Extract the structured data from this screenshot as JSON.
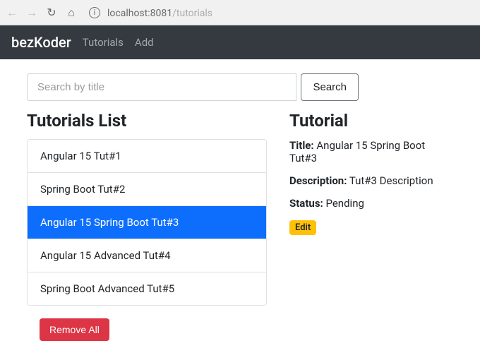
{
  "browser": {
    "host": "localhost:",
    "port": "8081",
    "path": "/tutorials"
  },
  "navbar": {
    "brand": "bezKoder",
    "links": [
      "Tutorials",
      "Add"
    ]
  },
  "search": {
    "placeholder": "Search by title",
    "button": "Search"
  },
  "list": {
    "heading": "Tutorials List",
    "items": [
      "Angular 15 Tut#1",
      "Spring Boot Tut#2",
      "Angular 15 Spring Boot Tut#3",
      "Angular 15 Advanced Tut#4",
      "Spring Boot Advanced Tut#5"
    ],
    "activeIndex": 2,
    "removeAll": "Remove All"
  },
  "detail": {
    "heading": "Tutorial",
    "titleLabel": "Title:",
    "titleValue": "Angular 15 Spring Boot Tut#3",
    "descLabel": "Description:",
    "descValue": "Tut#3 Description",
    "statusLabel": "Status:",
    "statusValue": "Pending",
    "editLabel": "Edit"
  }
}
